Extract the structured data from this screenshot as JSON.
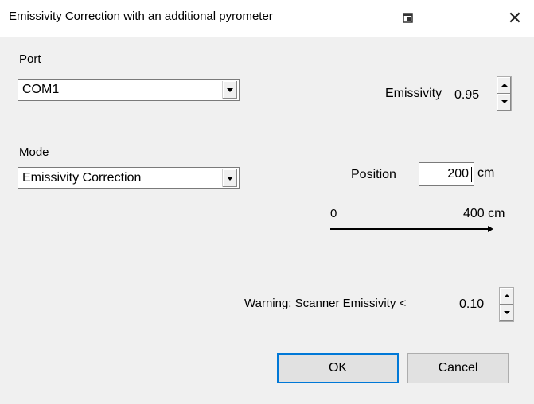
{
  "window": {
    "title": "Emissivity Correction with an additional pyrometer",
    "close_glyph": "✕"
  },
  "port": {
    "label": "Port",
    "value": "COM1"
  },
  "mode": {
    "label": "Mode",
    "value": "Emissivity Correction"
  },
  "emissivity": {
    "label": "Emissivity",
    "value": "0.95"
  },
  "position": {
    "label": "Position",
    "value": "200",
    "unit": "cm"
  },
  "scale": {
    "min_label": "0",
    "max_label": "400 cm"
  },
  "warning": {
    "label": "Warning: Scanner Emissivity <",
    "value": "0.10"
  },
  "buttons": {
    "ok": "OK",
    "cancel": "Cancel"
  },
  "colors": {
    "dialog_bg": "#f0f0f0",
    "titlebar_bg": "#ffffff",
    "default_button_border": "#0078d7"
  }
}
